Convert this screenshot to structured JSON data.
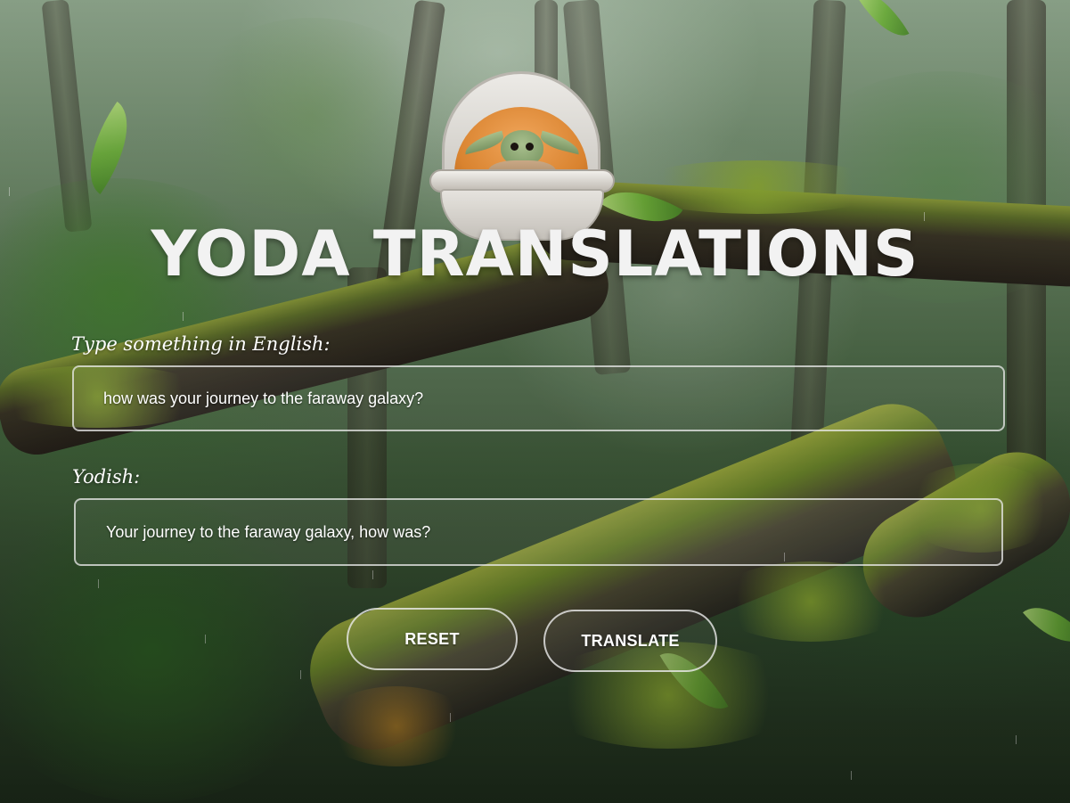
{
  "header": {
    "title": "YODA TRANSLATIONS",
    "mascot_icon": "grogu-pod-icon"
  },
  "form": {
    "input_label": "Type something in English:",
    "input_value": "how was your journey to the faraway galaxy?",
    "output_label": "Yodish:",
    "output_value": "Your journey to the faraway galaxy, how was?"
  },
  "buttons": {
    "reset_label": "RESET",
    "translate_label": "TRANSLATE"
  },
  "background": {
    "theme": "misty forest with mossy fallen log",
    "decoration_icon": "leaf-icon"
  }
}
